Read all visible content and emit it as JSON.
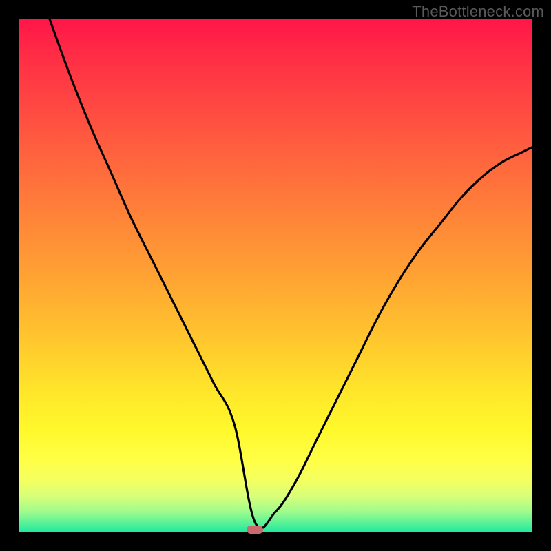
{
  "watermark": "TheBottleneck.com",
  "colors": {
    "frame": "#000000",
    "gradient_top": "#ff1648",
    "gradient_mid": "#ffe72a",
    "gradient_bottom": "#1ee8a0",
    "curve": "#000000",
    "marker": "#c96a6d",
    "watermark_text": "#5a5a5a"
  },
  "chart_data": {
    "type": "line",
    "title": "",
    "xlabel": "",
    "ylabel": "",
    "xlim": [
      0,
      100
    ],
    "ylim": [
      0,
      100
    ],
    "grid": false,
    "legend": false,
    "marker_x": 46,
    "series": [
      {
        "name": "bottleneck-curve",
        "x": [
          6,
          10,
          14,
          18,
          22,
          26,
          30,
          34,
          38,
          42,
          46,
          50,
          54,
          58,
          62,
          66,
          70,
          74,
          78,
          82,
          86,
          90,
          94,
          98,
          100
        ],
        "y": [
          100,
          89,
          79,
          70,
          61,
          53,
          45,
          37,
          29,
          21,
          2,
          4,
          10,
          18,
          26,
          34,
          42,
          49,
          55,
          60,
          65,
          69,
          72,
          74,
          75
        ]
      }
    ],
    "annotations": []
  }
}
